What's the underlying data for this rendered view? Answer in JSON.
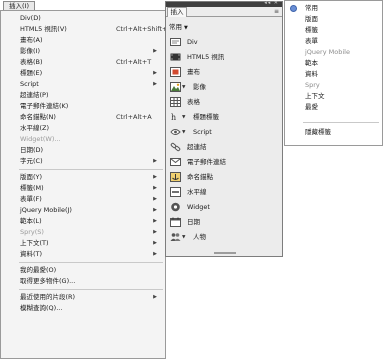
{
  "menu": {
    "tab_label": "插入(I)",
    "items": [
      {
        "label": "Div(D)",
        "shortcut": "",
        "arrow": false,
        "disabled": false
      },
      {
        "label": "HTML5 視訊(V)",
        "shortcut": "Ctrl+Alt+Shift+V",
        "arrow": false,
        "disabled": false
      },
      {
        "label": "畫布(A)",
        "shortcut": "",
        "arrow": false,
        "disabled": false
      },
      {
        "label": "影像(I)",
        "shortcut": "",
        "arrow": true,
        "disabled": false
      },
      {
        "label": "表格(B)",
        "shortcut": "Ctrl+Alt+T",
        "arrow": false,
        "disabled": false
      },
      {
        "label": "標題(E)",
        "shortcut": "",
        "arrow": true,
        "disabled": false
      },
      {
        "label": "Script",
        "shortcut": "",
        "arrow": true,
        "disabled": false
      },
      {
        "label": "超連結(P)",
        "shortcut": "",
        "arrow": false,
        "disabled": false
      },
      {
        "label": "電子郵件連結(K)",
        "shortcut": "",
        "arrow": false,
        "disabled": false
      },
      {
        "label": "命名錨點(N)",
        "shortcut": "Ctrl+Alt+A",
        "arrow": false,
        "disabled": false
      },
      {
        "label": "水平線(Z)",
        "shortcut": "",
        "arrow": false,
        "disabled": false
      },
      {
        "label": "Widget(W)...",
        "shortcut": "",
        "arrow": false,
        "disabled": true
      },
      {
        "label": "日期(D)",
        "shortcut": "",
        "arrow": false,
        "disabled": false
      },
      {
        "label": "字元(C)",
        "shortcut": "",
        "arrow": true,
        "disabled": false
      },
      {
        "label": "版面(Y)",
        "shortcut": "",
        "arrow": true,
        "disabled": false
      },
      {
        "label": "標籤(M)",
        "shortcut": "",
        "arrow": true,
        "disabled": false
      },
      {
        "label": "表單(F)",
        "shortcut": "",
        "arrow": true,
        "disabled": false
      },
      {
        "label": "jQuery Mobile(J)",
        "shortcut": "",
        "arrow": true,
        "disabled": false
      },
      {
        "label": "範本(L)",
        "shortcut": "",
        "arrow": true,
        "disabled": false
      },
      {
        "label": "Spry(S)",
        "shortcut": "",
        "arrow": true,
        "disabled": true
      },
      {
        "label": "上下文(T)",
        "shortcut": "",
        "arrow": true,
        "disabled": false
      },
      {
        "label": "資料(T)",
        "shortcut": "",
        "arrow": true,
        "disabled": false
      },
      {
        "label": "我的最愛(O)",
        "shortcut": "",
        "arrow": false,
        "disabled": false
      },
      {
        "label": "取得更多物件(G)...",
        "shortcut": "",
        "arrow": false,
        "disabled": false
      },
      {
        "label": "最近使用的片段(R)",
        "shortcut": "",
        "arrow": true,
        "disabled": false
      },
      {
        "label": "模糊查詢(Q)...",
        "shortcut": "",
        "arrow": false,
        "disabled": false
      }
    ]
  },
  "panel": {
    "tab_label": "插入",
    "category_label": "常用",
    "items": [
      {
        "label": "Div",
        "icon": "div-icon",
        "has_caret": false
      },
      {
        "label": "HTML5 視訊",
        "icon": "video-icon",
        "has_caret": false
      },
      {
        "label": "畫布",
        "icon": "canvas-icon",
        "has_caret": false
      },
      {
        "label": "影像",
        "icon": "image-icon",
        "has_caret": true
      },
      {
        "label": "表格",
        "icon": "table-icon",
        "has_caret": false
      },
      {
        "label": "標題標籤",
        "icon": "heading-icon",
        "has_caret": true
      },
      {
        "label": "Script",
        "icon": "script-icon",
        "has_caret": true
      },
      {
        "label": "超連結",
        "icon": "link-icon",
        "has_caret": false
      },
      {
        "label": "電子郵件連結",
        "icon": "email-icon",
        "has_caret": false
      },
      {
        "label": "命名錨點",
        "icon": "anchor-icon",
        "has_caret": false
      },
      {
        "label": "水平線",
        "icon": "hr-icon",
        "has_caret": false
      },
      {
        "label": "Widget",
        "icon": "widget-icon",
        "has_caret": false
      },
      {
        "label": "日期",
        "icon": "date-icon",
        "has_caret": false
      },
      {
        "label": "人物",
        "icon": "people-icon",
        "has_caret": true
      }
    ]
  },
  "categories": {
    "selected": "常用",
    "items": [
      {
        "label": "常用",
        "checked": true,
        "dim": false
      },
      {
        "label": "版面",
        "checked": false,
        "dim": false
      },
      {
        "label": "標籤",
        "checked": false,
        "dim": false
      },
      {
        "label": "表單",
        "checked": false,
        "dim": false
      },
      {
        "label": "jQuery Mobile",
        "checked": false,
        "dim": true
      },
      {
        "label": "範本",
        "checked": false,
        "dim": false
      },
      {
        "label": "資料",
        "checked": false,
        "dim": false
      },
      {
        "label": "Spry",
        "checked": false,
        "dim": true
      },
      {
        "label": "上下文",
        "checked": false,
        "dim": false
      },
      {
        "label": "最愛",
        "checked": false,
        "dim": false
      },
      {
        "label": "隱藏標籤",
        "checked": false,
        "dim": false
      }
    ]
  }
}
